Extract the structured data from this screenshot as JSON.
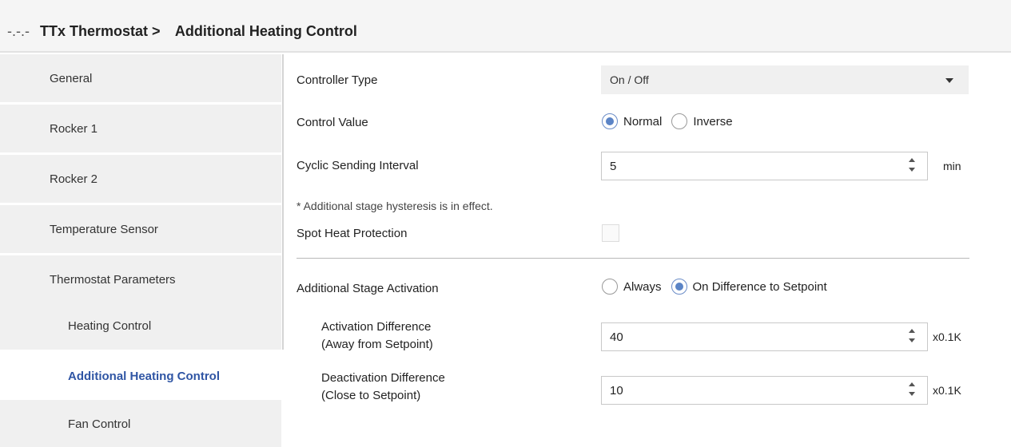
{
  "header": {
    "dots": "-.-.-",
    "parent": "TTx Thermostat >",
    "title": "Additional Heating Control"
  },
  "sidebar": {
    "items": [
      {
        "label": "General"
      },
      {
        "label": "Rocker 1"
      },
      {
        "label": "Rocker 2"
      },
      {
        "label": "Temperature Sensor"
      },
      {
        "label": "Thermostat Parameters"
      },
      {
        "label": "Heating Control"
      },
      {
        "label": "Additional Heating Control"
      },
      {
        "label": "Fan Control"
      }
    ]
  },
  "main": {
    "controller_type": {
      "label": "Controller Type",
      "value": "On / Off"
    },
    "control_value": {
      "label": "Control Value",
      "options": [
        "Normal",
        "Inverse"
      ],
      "selected": "Normal"
    },
    "cyclic_interval": {
      "label": "Cyclic Sending Interval",
      "value": "5",
      "unit": "min"
    },
    "hysteresis_note": "* Additional stage hysteresis is in effect.",
    "spot_heat": {
      "label": "Spot Heat Protection",
      "checked": false
    },
    "stage_activation": {
      "label": "Additional Stage Activation",
      "options": [
        "Always",
        "On Difference to Setpoint"
      ],
      "selected": "On Difference to Setpoint"
    },
    "activation_diff": {
      "label_line1": "Activation Difference",
      "label_line2": "(Away from Setpoint)",
      "value": "40",
      "unit": "x0.1K"
    },
    "deactivation_diff": {
      "label_line1": "Deactivation Difference",
      "label_line2": "(Close to Setpoint)",
      "value": "10",
      "unit": "x0.1K"
    }
  },
  "colors": {
    "accent": "#2f55a4",
    "radio_fill": "#5b84c6",
    "sidebar_bg": "#f0f0f0"
  }
}
